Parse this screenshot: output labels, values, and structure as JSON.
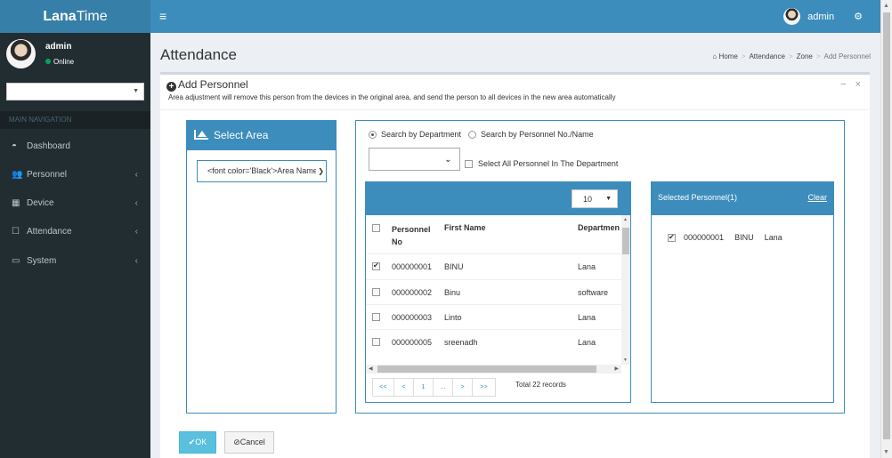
{
  "brand": {
    "bold": "Lana",
    "light": "Time"
  },
  "topbar": {
    "menu_icon": "hamburger-icon",
    "user": "admin",
    "settings_icon": "gears-icon"
  },
  "sidebar": {
    "user_name": "admin",
    "status": "Online",
    "nav_header": "MAIN NAVIGATION",
    "items": [
      {
        "label": "Dashboard",
        "icon": "dashboard-icon",
        "arrow": ""
      },
      {
        "label": "Personnel",
        "icon": "users-icon",
        "arrow": "‹"
      },
      {
        "label": "Device",
        "icon": "device-icon",
        "arrow": "‹"
      },
      {
        "label": "Attendance",
        "icon": "attendance-icon",
        "arrow": "‹"
      },
      {
        "label": "System",
        "icon": "laptop-icon",
        "arrow": "‹"
      }
    ]
  },
  "page": {
    "title": "Attendance",
    "breadcrumb": [
      "Home",
      "Attendance",
      "Zone",
      "Add Personnel"
    ]
  },
  "box": {
    "title": "Add Personnel",
    "note": "Area adjustment will remove this person from the devices in the original area, and send the person to all devices in the new area automatically",
    "minimize": "−",
    "close": "×"
  },
  "area": {
    "title": "Select Area",
    "select_value": "<font color='Black'>Area Name"
  },
  "search": {
    "option1": "Search by Department",
    "option2": "Search by Personnel No./Name",
    "select_all": "Select All Personnel In The Department",
    "page_size": "10",
    "headers": {
      "no_line1": "Personnel",
      "no_line2": "No",
      "first_name": "First Name",
      "department": "Departmen"
    },
    "rows": [
      {
        "no": "000000001",
        "name": "BINU",
        "dept": "Lana",
        "checked": true
      },
      {
        "no": "000000002",
        "name": "Binu",
        "dept": "software",
        "checked": false
      },
      {
        "no": "000000003",
        "name": "Linto",
        "dept": "Lana",
        "checked": false
      },
      {
        "no": "000000005",
        "name": "sreenadh",
        "dept": "Lana",
        "checked": false
      }
    ],
    "pager": [
      "<<",
      "<",
      "1",
      "...",
      ">",
      ">>"
    ],
    "total": "Total 22 records"
  },
  "selected": {
    "title": "Selected Personnel(1)",
    "clear": "Clear",
    "row": {
      "no": "000000001",
      "name": "BINU",
      "dept": "Lana"
    }
  },
  "footer": {
    "ok": "OK",
    "cancel": "Cancel"
  }
}
